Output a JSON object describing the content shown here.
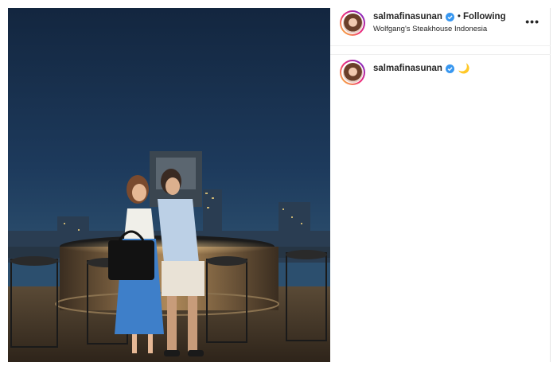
{
  "post": {
    "username": "salmafinasunan",
    "separator": "•",
    "follow_label": "Following",
    "location": "Wolfgang's Steakhouse Indonesia",
    "more_label": "•••"
  },
  "caption": {
    "username": "salmafinasunan",
    "text": "🌙"
  },
  "icons": {
    "verified": "verified-badge-icon",
    "more": "more-options-icon"
  },
  "colors": {
    "verified": "#3897f0",
    "sky": "#1b3354",
    "deck": "#4a3b2a"
  }
}
